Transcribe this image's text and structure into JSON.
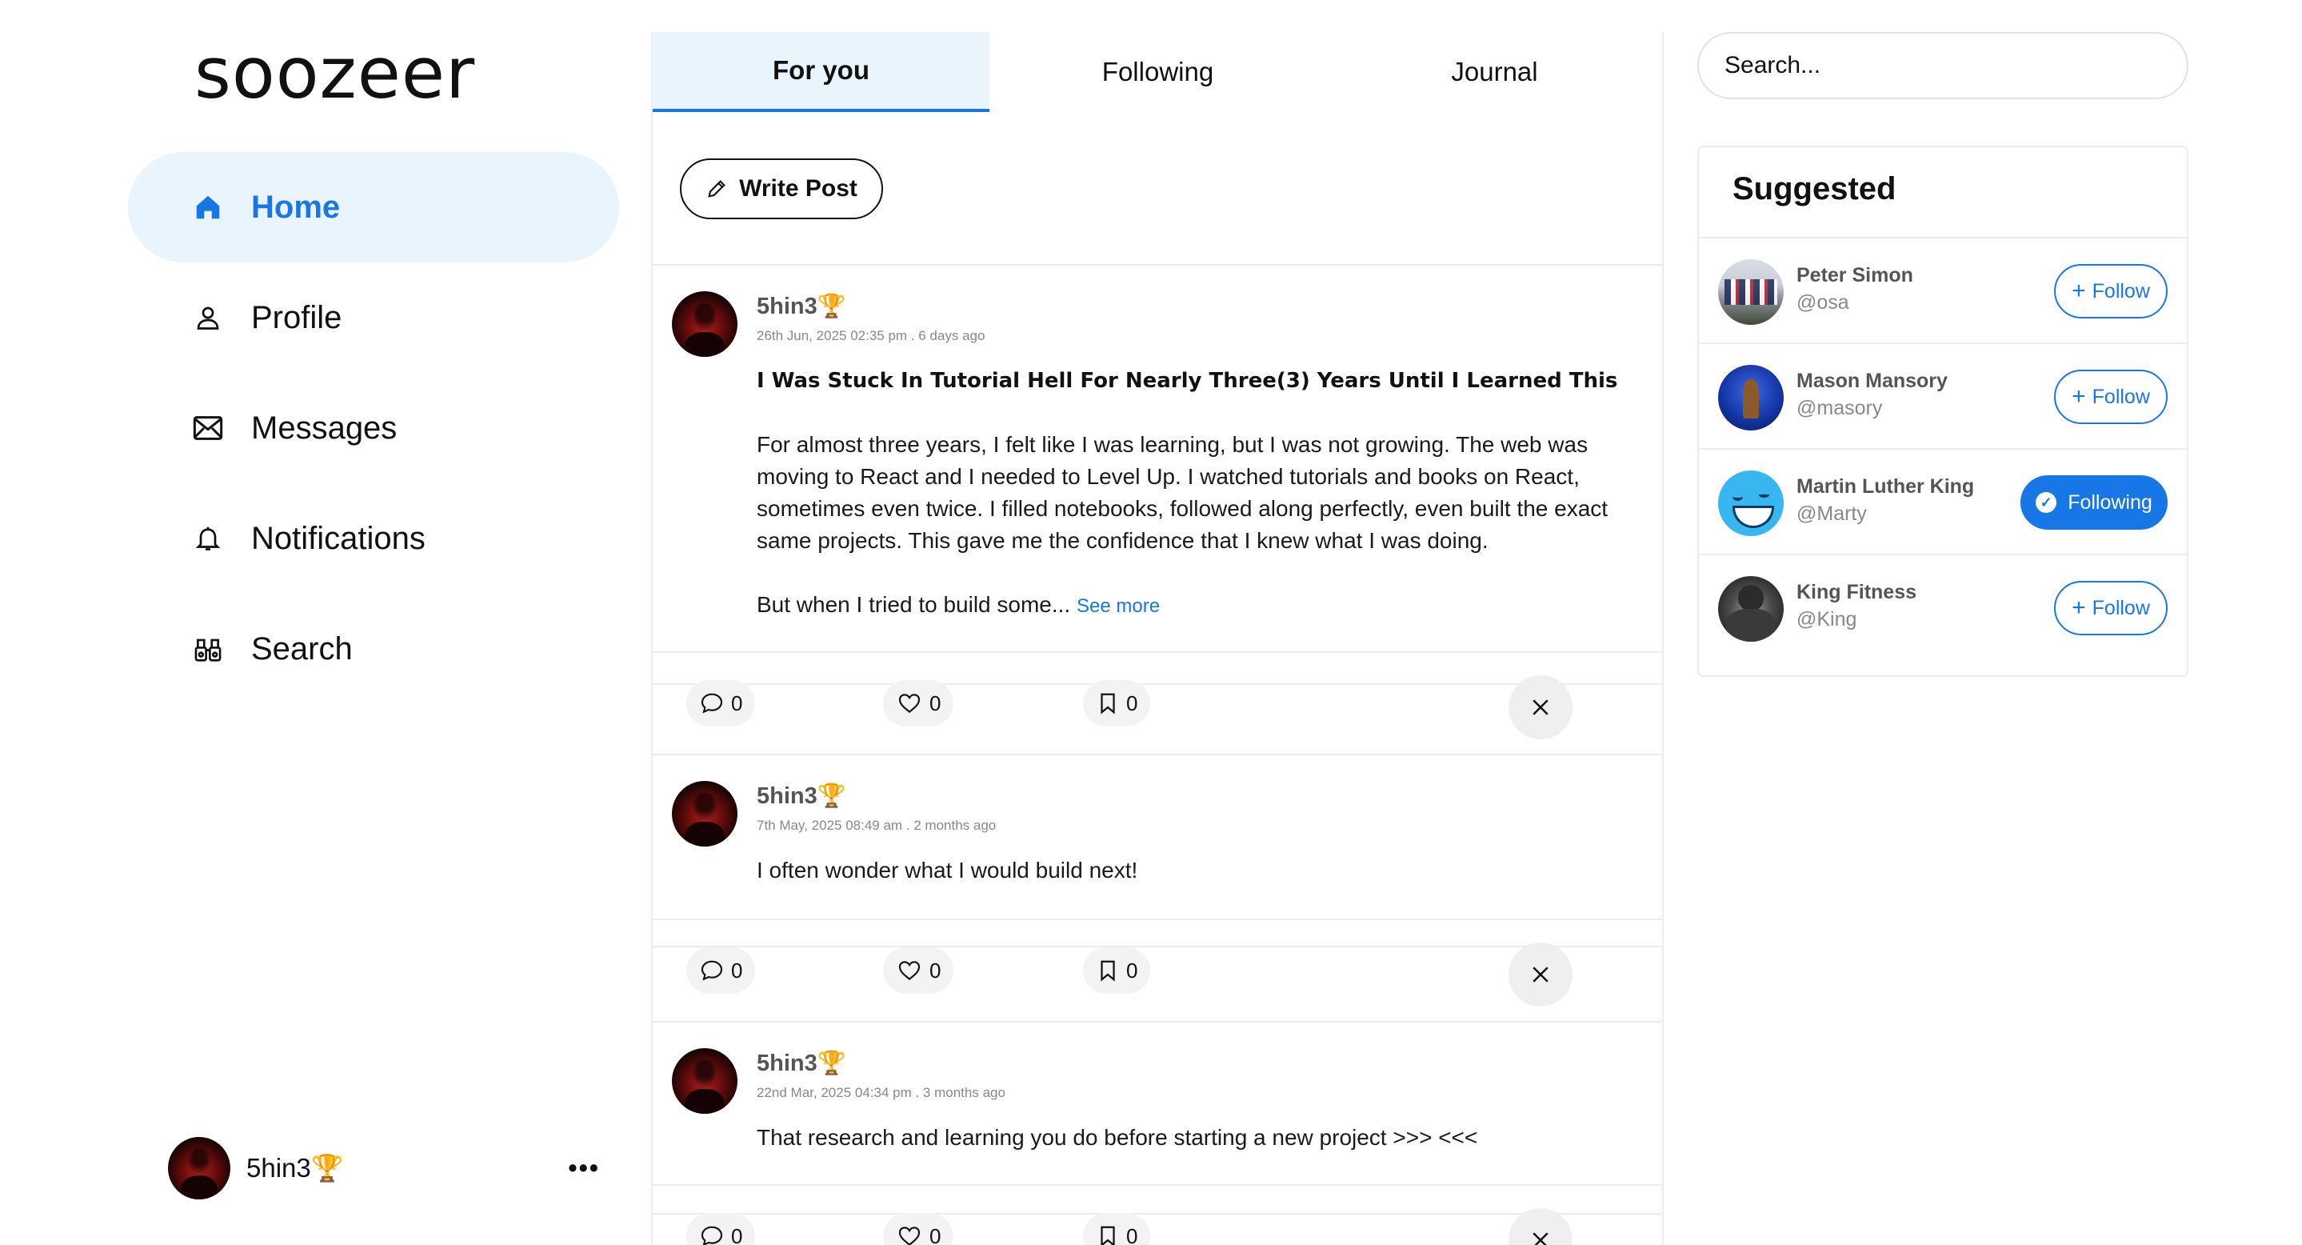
{
  "brand": {
    "logo": "soozeer"
  },
  "nav": [
    {
      "label": "Home",
      "icon": "home-icon",
      "active": true
    },
    {
      "label": "Profile",
      "icon": "user-icon",
      "active": false
    },
    {
      "label": "Messages",
      "icon": "mail-icon",
      "active": false
    },
    {
      "label": "Notifications",
      "icon": "bell-icon",
      "active": false
    },
    {
      "label": "Search",
      "icon": "binoculars-icon",
      "active": false
    }
  ],
  "current_user": {
    "name": "5hin3🏆",
    "more": "•••"
  },
  "tabs": [
    {
      "label": "For you",
      "active": true
    },
    {
      "label": "Following",
      "active": false
    },
    {
      "label": "Journal",
      "active": false
    }
  ],
  "compose": {
    "label": "Write Post"
  },
  "posts": [
    {
      "author": "5hin3🏆",
      "meta": "26th Jun, 2025 02:35 pm . 6 days ago",
      "title": "I Was Stuck In Tutorial Hell For Nearly Three(3) Years Until I Learned This",
      "paragraph1": "For almost three years, I felt like I was learning, but I was not growing.  The web was moving to React and I needed to Level Up. I watched tutorials and books on React, sometimes even twice. I filled notebooks, followed along perfectly, even built the exact same projects. This gave me the confidence that I knew what I was doing.",
      "paragraph2": "But when I tried to build some...",
      "see_more": "See more",
      "comments": "0",
      "likes": "0",
      "saves": "0"
    },
    {
      "author": "5hin3🏆",
      "meta": "7th May, 2025 08:49 am . 2 months ago",
      "text": "I often wonder what I would build next!",
      "comments": "0",
      "likes": "0",
      "saves": "0"
    },
    {
      "author": "5hin3🏆",
      "meta": "22nd Mar, 2025 04:34 pm . 3 months ago",
      "text": "That research and learning you do before starting a new project >>> <<<",
      "comments": "0",
      "likes": "0",
      "saves": "0"
    }
  ],
  "search": {
    "placeholder": "Search..."
  },
  "suggested": {
    "title": "Suggested",
    "users": [
      {
        "name": "Peter Simon",
        "handle": "@osa",
        "button": "Follow",
        "following": false
      },
      {
        "name": "Mason Mansory",
        "handle": "@masory",
        "button": "Follow",
        "following": false
      },
      {
        "name": "Martin Luther King",
        "handle": "@Marty",
        "button": "Following",
        "following": true
      },
      {
        "name": "King Fitness",
        "handle": "@King",
        "button": "Follow",
        "following": false
      }
    ]
  },
  "colors": {
    "accent": "#1777e6",
    "active_bg": "#eaf4fd",
    "border": "#ececec"
  }
}
